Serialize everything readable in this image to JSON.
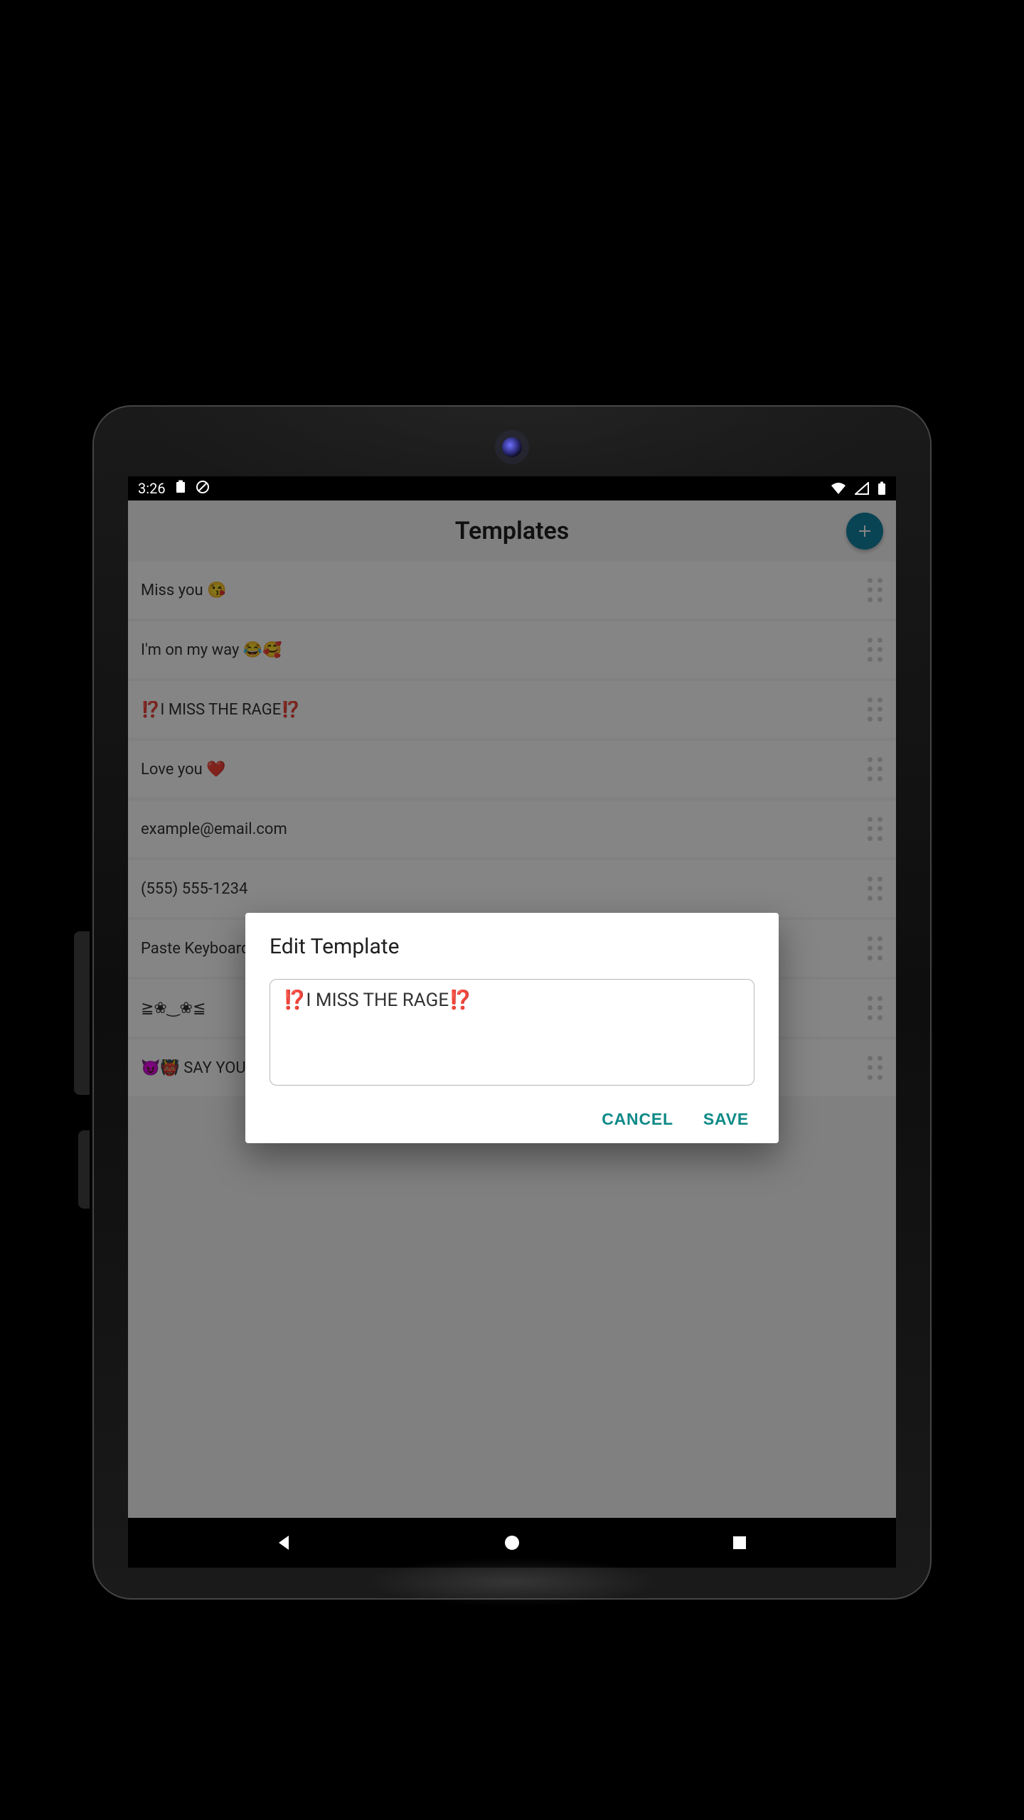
{
  "status": {
    "time": "3:26"
  },
  "header": {
    "title": "Templates"
  },
  "templates": [
    {
      "text": "Miss you 😘"
    },
    {
      "text": "I'm on my way 😂🥰"
    },
    {
      "text": "⁉️I MISS THE RAGE⁉️"
    },
    {
      "text": "Love you ❤️"
    },
    {
      "text": "example@email.com"
    },
    {
      "text": "(555) 555-1234"
    },
    {
      "text": "Paste Keyboard"
    },
    {
      "text": "≧❀‿❀≦"
    },
    {
      "text": "😈👹 SAY YOU A"
    }
  ],
  "dialog": {
    "title": "Edit Template",
    "value": "⁉️I MISS THE RAGE⁉️",
    "cancel_label": "CANCEL",
    "save_label": "SAVE"
  }
}
